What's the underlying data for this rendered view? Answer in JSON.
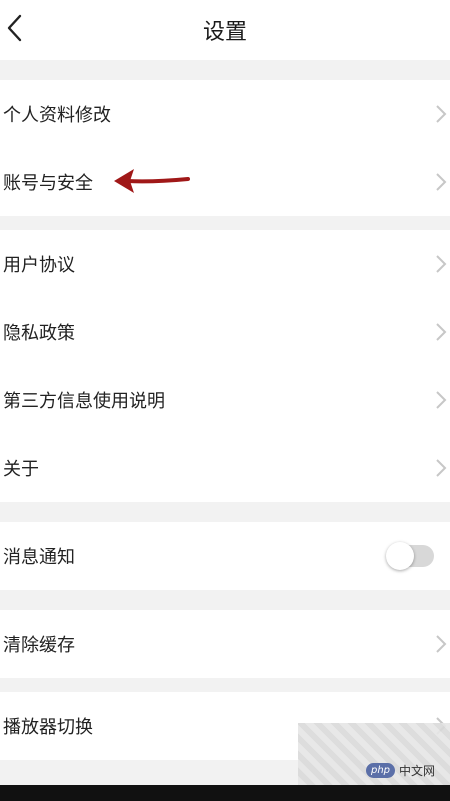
{
  "header": {
    "title": "设置"
  },
  "sections": [
    {
      "items": [
        {
          "label": "个人资料修改",
          "type": "link"
        },
        {
          "label": "账号与安全",
          "type": "link"
        }
      ]
    },
    {
      "items": [
        {
          "label": "用户协议",
          "type": "link"
        },
        {
          "label": "隐私政策",
          "type": "link"
        },
        {
          "label": "第三方信息使用说明",
          "type": "link"
        },
        {
          "label": "关于",
          "type": "link"
        }
      ]
    },
    {
      "items": [
        {
          "label": "消息通知",
          "type": "toggle",
          "on": false
        }
      ]
    },
    {
      "items": [
        {
          "label": "清除缓存",
          "type": "link"
        }
      ]
    },
    {
      "items": [
        {
          "label": "播放器切换",
          "type": "link"
        }
      ]
    }
  ],
  "annotation": {
    "arrow_color": "#a01818"
  },
  "watermark": {
    "badge": "php",
    "text": "中文网"
  },
  "colors": {
    "background": "#f2f2f2",
    "panel": "#ffffff",
    "chevron": "#c7c7c7"
  }
}
